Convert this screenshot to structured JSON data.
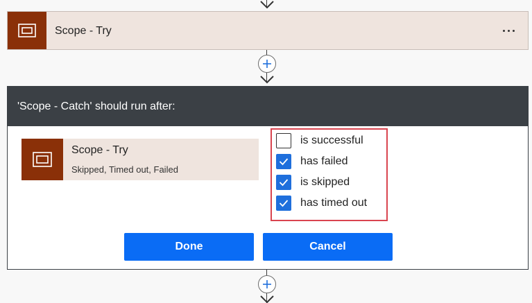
{
  "top_action": {
    "title": "Scope - Try",
    "icon": "scope-icon",
    "more_icon": "ellipsis-icon"
  },
  "dialog": {
    "header": "'Scope - Catch' should run after:",
    "source_action": {
      "title": "Scope - Try",
      "subtitle": "Skipped, Timed out, Failed",
      "icon": "scope-icon"
    },
    "options": [
      {
        "label": "is successful",
        "checked": false
      },
      {
        "label": "has failed",
        "checked": true
      },
      {
        "label": "is skipped",
        "checked": true
      },
      {
        "label": "has timed out",
        "checked": true
      }
    ],
    "done_label": "Done",
    "cancel_label": "Cancel"
  },
  "colors": {
    "scope_icon_bg": "#8a3008",
    "card_bg": "#efe4de",
    "header_bg": "#3b4045",
    "primary_button": "#0a6cf5",
    "checkbox_checked": "#1f6fdc",
    "highlight_border": "#d9444f"
  }
}
